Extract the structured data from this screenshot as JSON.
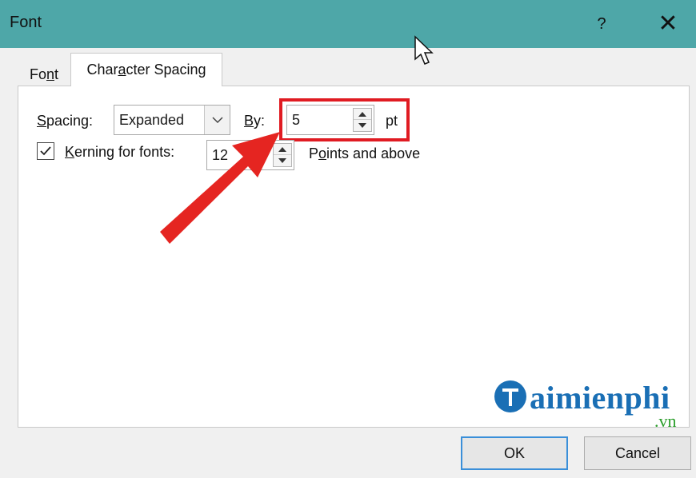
{
  "window": {
    "title": "Font",
    "help_label": "?",
    "close_label": "✕"
  },
  "tabs": [
    {
      "label": "Font",
      "mnemonic_index": 2
    },
    {
      "label": "Character Spacing",
      "mnemonic_index": 3,
      "active": true
    }
  ],
  "spacing": {
    "label": "Spacing:",
    "value": "Expanded",
    "by_label": "By:",
    "by_value": "5",
    "unit": "pt"
  },
  "kerning": {
    "label": "Kerning for fonts:",
    "checked": true,
    "value": "12",
    "suffix": "Points and above"
  },
  "buttons": {
    "ok": "OK",
    "cancel": "Cancel"
  },
  "watermark": {
    "name": "aimienphi",
    "domain": ".vn"
  },
  "colors": {
    "titlebar": "#4ea7a8",
    "highlight": "#e01b22",
    "arrow": "#e52521",
    "logo": "#1a6fb5"
  }
}
